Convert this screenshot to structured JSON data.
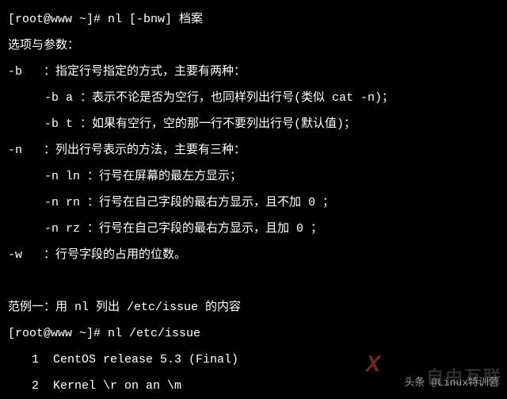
{
  "prompt1": "[root@www ~]# nl [-bnw] 档案",
  "header": "选项与参数：",
  "opt_b": "-b   ：指定行号指定的方式，主要有两种：",
  "opt_b_a": "-b a ：表示不论是否为空行，也同样列出行号(类似 cat -n)；",
  "opt_b_t": "-b t ：如果有空行，空的那一行不要列出行号(默认值)；",
  "opt_n": "-n   ：列出行号表示的方法，主要有三种：",
  "opt_n_ln": "-n ln ：行号在屏幕的最左方显示；",
  "opt_n_rn": "-n rn ：行号在自己字段的最右方显示，且不加 0 ；",
  "opt_n_rz": "-n rz ：行号在自己字段的最右方显示，且加 0 ；",
  "opt_w": "-w   ：行号字段的占用的位数。",
  "blank": " ",
  "example_header": "范例一：用 nl 列出 /etc/issue 的内容",
  "prompt2": "[root@www ~]# nl /etc/issue",
  "out1": "1  CentOS release 5.3 (Final)",
  "out2": "2  Kernel \\r on an \\m",
  "watermark_source": "头条 @Linux特训营",
  "watermark_bg": "自由互联",
  "watermark_x": "X"
}
